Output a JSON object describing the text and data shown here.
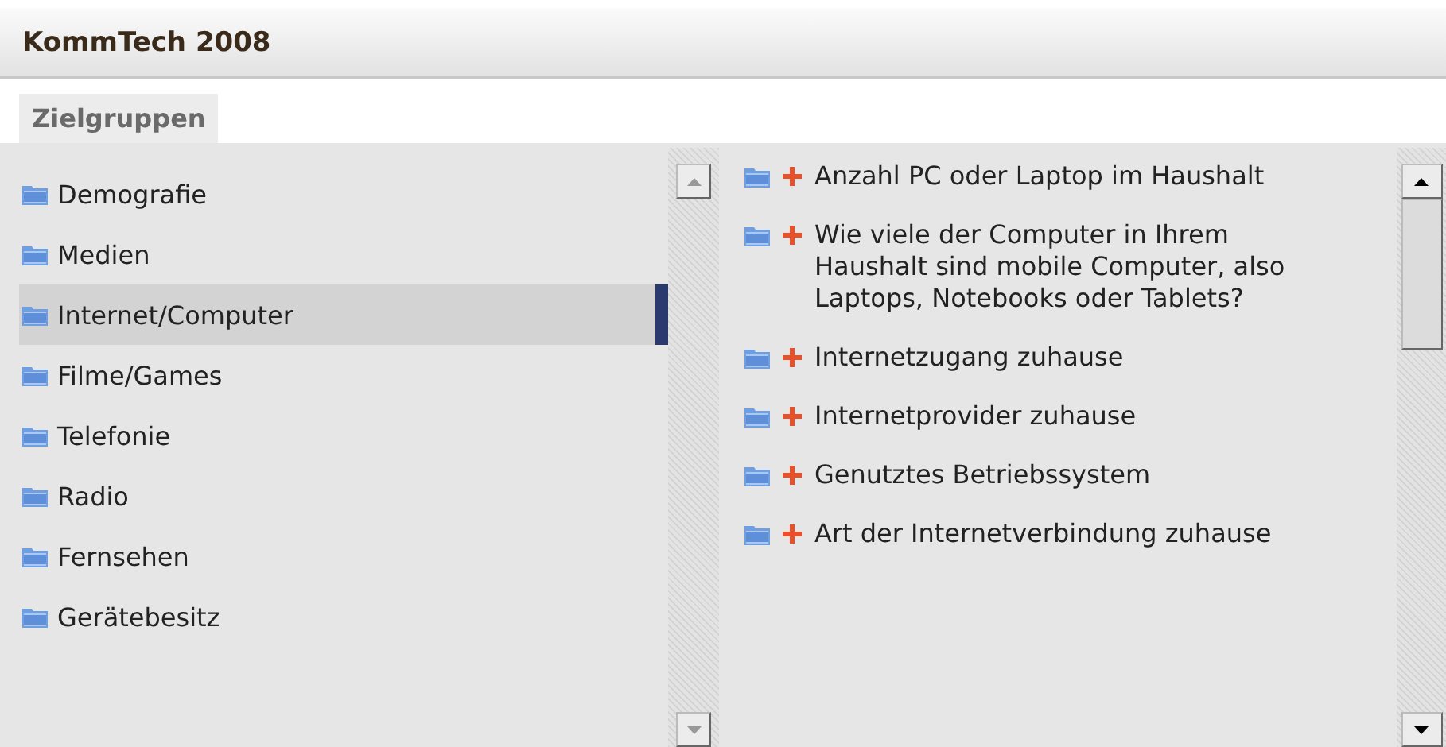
{
  "window": {
    "title": "KommTech 2008"
  },
  "tabs": [
    {
      "label": "Zielgruppen",
      "selected": true
    }
  ],
  "categories": [
    {
      "label": "Demografie",
      "selected": false
    },
    {
      "label": "Medien",
      "selected": false
    },
    {
      "label": "Internet/Computer",
      "selected": true
    },
    {
      "label": "Filme/Games",
      "selected": false
    },
    {
      "label": "Telefonie",
      "selected": false
    },
    {
      "label": "Radio",
      "selected": false
    },
    {
      "label": "Fernsehen",
      "selected": false
    },
    {
      "label": "Gerätebesitz",
      "selected": false
    }
  ],
  "questions": [
    {
      "label": "Anzahl PC oder Laptop im Haushalt"
    },
    {
      "label": "Wie viele der Computer in Ihrem Haushalt sind mobile Computer, also Laptops, Notebooks oder Tablets?"
    },
    {
      "label": "Internetzugang zuhause"
    },
    {
      "label": "Internetprovider zuhause"
    },
    {
      "label": "Genutztes Betriebssystem"
    },
    {
      "label": "Art der Internetverbindung zuhause"
    }
  ]
}
